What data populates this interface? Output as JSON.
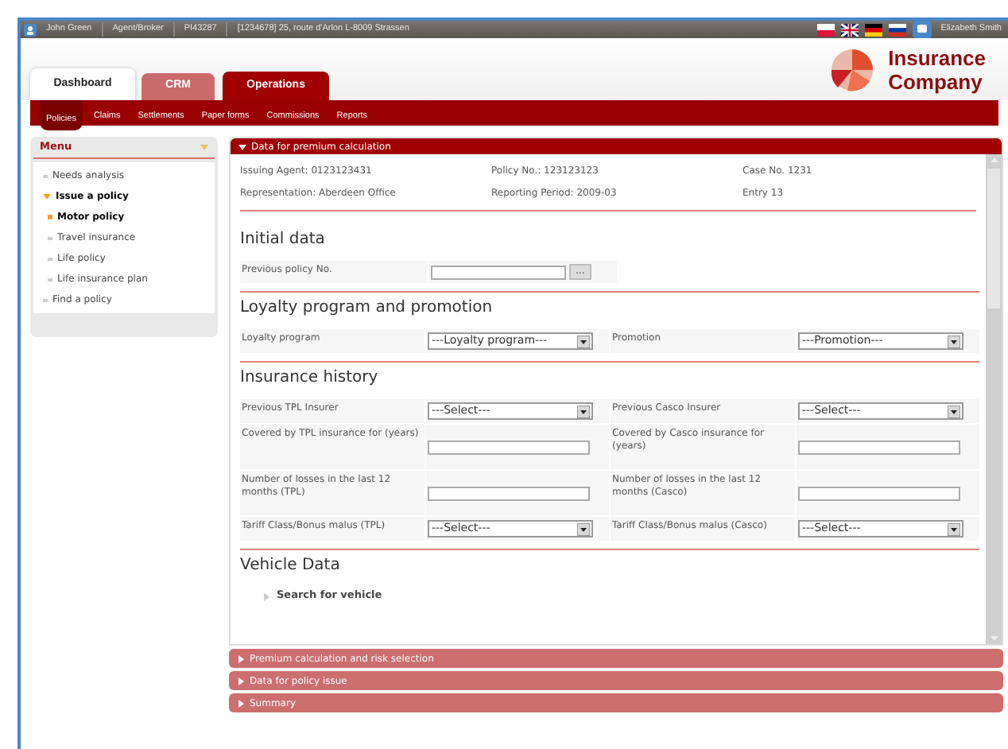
{
  "user_bar": {
    "items": [
      "John Green",
      "Agent/Broker",
      "PI43287",
      "[1234678] 25, route d'Arlon L-8009 Strassen"
    ],
    "user_name": "Elizabeth Smith"
  },
  "logo": {
    "lines": [
      "Insurance",
      "Company"
    ]
  },
  "main_tabs": [
    {
      "label": "Dashboard",
      "kind": "home",
      "selected": false
    },
    {
      "label": "CRM",
      "kind": "module",
      "selected": false
    },
    {
      "label": "Operations",
      "kind": "module",
      "selected": true
    }
  ],
  "sub_tabs": [
    {
      "label": "Policies",
      "selected": true
    },
    {
      "label": "Claims",
      "selected": false
    },
    {
      "label": "Settlements",
      "selected": false
    },
    {
      "label": "Paper forms",
      "selected": false
    },
    {
      "label": "Commissions",
      "selected": false
    },
    {
      "label": "Reports",
      "selected": false
    }
  ],
  "sidebar": {
    "title": "Menu",
    "items": [
      {
        "label": "Needs analysis",
        "selected": false
      },
      {
        "label": "Issue a policy",
        "selected": false,
        "expanded": true,
        "children": [
          {
            "label": "Motor policy",
            "selected": true
          },
          {
            "label": "Travel insurance",
            "selected": false
          },
          {
            "label": "Life policy",
            "selected": false
          },
          {
            "label": "Life insurance plan",
            "selected": false
          }
        ]
      },
      {
        "label": "Find a policy",
        "selected": false
      }
    ]
  },
  "panel": {
    "title": "Data for premium calculation",
    "expanded": true,
    "info": [
      [
        "Issuing Agent: 0123123431",
        "Policy No.: 123123123",
        "Case No. 1231"
      ],
      [
        "Representation: Aberdeen Office",
        "Reporting Period: 2009-03",
        "Entry 13"
      ]
    ],
    "sections": [
      {
        "title": "Initial data",
        "rows": [
          [
            {
              "label": "Previous policy No.",
              "kind": "lookup",
              "button": "..."
            }
          ]
        ]
      },
      {
        "title": "Loyalty program and promotion",
        "rows": [
          [
            {
              "label": "Loyalty program",
              "kind": "select",
              "value": "---Loyalty program---"
            },
            {
              "label": "Promotion",
              "kind": "select",
              "value": "---Promotion---"
            }
          ]
        ]
      },
      {
        "title": "Insurance history",
        "rows": [
          [
            {
              "label": "Previous TPL Insurer",
              "kind": "select",
              "value": "---Select---"
            },
            {
              "label": "Previous Casco Insurer",
              "kind": "select",
              "value": "---Select---"
            }
          ],
          [
            {
              "label": "Covered by TPL insurance for (years)",
              "kind": "text"
            },
            {
              "label": "Covered by Casco insurance for (years)",
              "kind": "text"
            }
          ],
          [
            {
              "label": "Number of losses in the last 12 months (TPL)",
              "kind": "text"
            },
            {
              "label": "Number of losses in the last 12 months (Casco)",
              "kind": "text"
            }
          ],
          [
            {
              "label": "Tariff Class/Bonus malus (TPL)",
              "kind": "select",
              "value": "---Select---"
            },
            {
              "label": "Tariff Class/Bonus malus (Casco)",
              "kind": "select",
              "value": "---Select---"
            }
          ]
        ]
      },
      {
        "title": "Vehicle Data",
        "links": [
          "Search for vehicle"
        ]
      }
    ]
  },
  "accordions": [
    {
      "title": "Premium calculation and risk selection",
      "expanded": false
    },
    {
      "title": "Data for policy issue",
      "expanded": false
    },
    {
      "title": "Summary",
      "expanded": false
    }
  ]
}
